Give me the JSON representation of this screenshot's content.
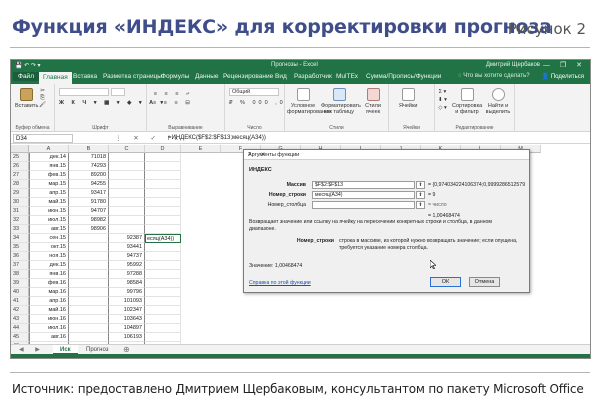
{
  "figure": {
    "title": "Функция «ИНДЕКС» для корректировки прогноза",
    "number": "Рисунок 2",
    "source": "Источник: предоставлено Дмитрием Щербаковым, консультантом по пакету Microsoft Office"
  },
  "titlebar": {
    "window_title": "Прогнозы - Excel",
    "user": "Дмитрий Щербаков"
  },
  "ribbon_tabs": [
    "Файл",
    "Главная",
    "Вставка",
    "Разметка страницы",
    "Формулы",
    "Данные",
    "Рецензирование",
    "Вид",
    "Разработчик",
    "MulTEx",
    "Сумма/Пропись/Функции"
  ],
  "tell_me": "Что вы хотите сделать?",
  "share": "Поделиться",
  "ribbon_groups": {
    "clipboard": "Буфер обмена",
    "font": "Шрифт",
    "alignment": "Выравнивание",
    "number": "Число",
    "styles": "Стили",
    "cells": "Ячейки",
    "editing": "Редактирование",
    "paste": "Вставить",
    "number_format": "Общий",
    "conditional": "Условное форматирование",
    "as_table": "Форматировать как таблицу",
    "cell_styles": "Стили ячеек",
    "cells_btn": "Ячейки",
    "sort": "Сортировка и фильтр",
    "find": "Найти и выделить"
  },
  "namebox": "D34",
  "formula": "=ИНДЕКС($F$2:$F$13;месяц(A34))",
  "columns": [
    "A",
    "B",
    "C",
    "D",
    "E",
    "F",
    "G",
    "H",
    "I",
    "J",
    "K",
    "L",
    "M"
  ],
  "rows": [
    {
      "n": "25",
      "a": "дек.14",
      "b": "71018",
      "c": "",
      "d": ""
    },
    {
      "n": "26",
      "a": "янв.15",
      "b": "74293",
      "c": "",
      "d": ""
    },
    {
      "n": "27",
      "a": "фев.15",
      "b": "89200",
      "c": "",
      "d": ""
    },
    {
      "n": "28",
      "a": "мар.15",
      "b": "94255",
      "c": "",
      "d": ""
    },
    {
      "n": "29",
      "a": "апр.15",
      "b": "93417",
      "c": "",
      "d": ""
    },
    {
      "n": "30",
      "a": "май.15",
      "b": "91780",
      "c": "",
      "d": ""
    },
    {
      "n": "31",
      "a": "июн.15",
      "b": "94707",
      "c": "",
      "d": ""
    },
    {
      "n": "32",
      "a": "июл.15",
      "b": "98982",
      "c": "",
      "d": ""
    },
    {
      "n": "33",
      "a": "авг.15",
      "b": "98906",
      "c": "",
      "d": ""
    },
    {
      "n": "34",
      "a": "сен.15",
      "b": "",
      "c": "92387",
      "d": "есяц(A34))"
    },
    {
      "n": "35",
      "a": "окт.15",
      "b": "",
      "c": "93441",
      "d": ""
    },
    {
      "n": "36",
      "a": "ноя.15",
      "b": "",
      "c": "94737",
      "d": ""
    },
    {
      "n": "37",
      "a": "дек.15",
      "b": "",
      "c": "95992",
      "d": ""
    },
    {
      "n": "38",
      "a": "янв.16",
      "b": "",
      "c": "97288",
      "d": ""
    },
    {
      "n": "39",
      "a": "фев.16",
      "b": "",
      "c": "98584",
      "d": ""
    },
    {
      "n": "40",
      "a": "мар.16",
      "b": "",
      "c": "99796",
      "d": ""
    },
    {
      "n": "41",
      "a": "апр.16",
      "b": "",
      "c": "101093",
      "d": ""
    },
    {
      "n": "42",
      "a": "май.16",
      "b": "",
      "c": "102347",
      "d": ""
    },
    {
      "n": "43",
      "a": "июн.16",
      "b": "",
      "c": "103643",
      "d": ""
    },
    {
      "n": "44",
      "a": "июл.16",
      "b": "",
      "c": "104897",
      "d": ""
    },
    {
      "n": "45",
      "a": "авг.16",
      "b": "",
      "c": "106193",
      "d": ""
    },
    {
      "n": "46",
      "a": "",
      "b": "",
      "c": "",
      "d": ""
    }
  ],
  "sheets": [
    "Иск",
    "Прогноз"
  ],
  "dialog": {
    "title": "Аргументы функции",
    "function_name": "ИНДЕКС",
    "args": [
      {
        "label": "Массив",
        "value": "$F$2:$F$13",
        "result": "= {0,974034224106374;0,9999286512579"
      },
      {
        "label": "Номер_строки",
        "value": "месяц(A34)",
        "result": "= 9"
      },
      {
        "label": "Номер_столбца",
        "value": "",
        "result": "= число"
      }
    ],
    "formula_result_line": "= 1,00468474",
    "description": "Возвращает значение или ссылку на ячейку на пересечении конкретных строки и столбца, в данном диапазоне.",
    "arg_help_label": "Номер_строки",
    "arg_help_text": "строка в массиве, из которой нужно возвращать значение; если опущена, требуется указание номера столбца.",
    "value_label": "Значение: 1,00468474",
    "help_link": "Справка по этой функции",
    "ok": "ОК",
    "cancel": "Отмена"
  }
}
